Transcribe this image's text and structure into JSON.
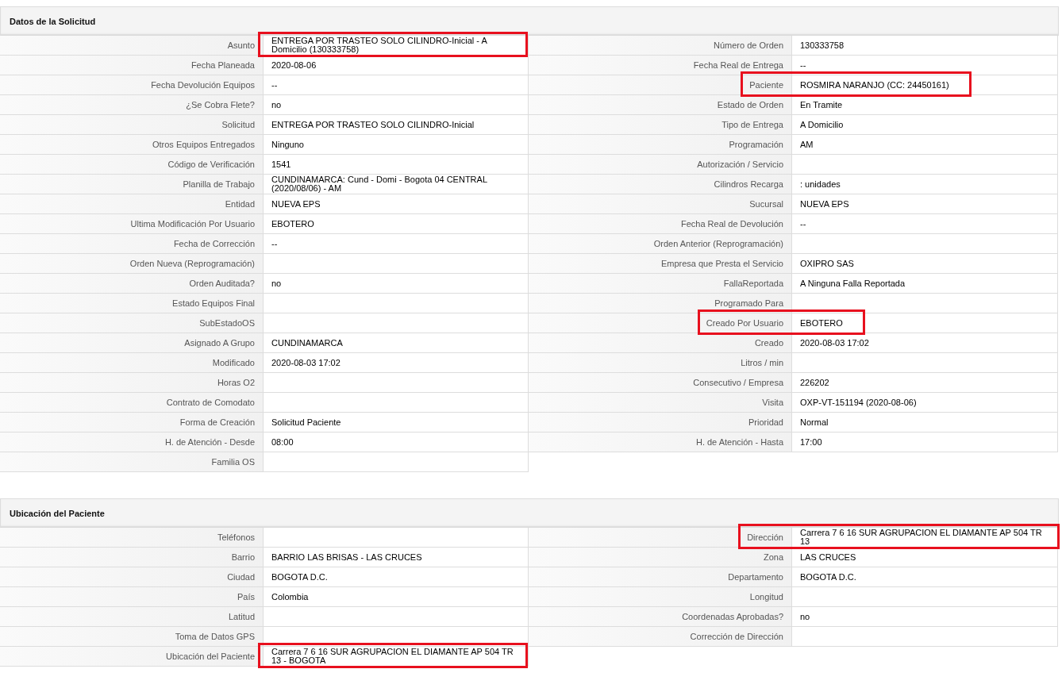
{
  "sections": [
    {
      "title": "Datos de la Solicitud",
      "left": [
        {
          "label": "Asunto",
          "value": "ENTREGA POR TRASTEO SOLO CILINDRO-Inicial - A Domicilio (130333758)",
          "highlighted": true
        },
        {
          "label": "Fecha Planeada",
          "value": "2020-08-06",
          "highlighted": false
        },
        {
          "label": "Fecha Devolución Equipos",
          "value": "--",
          "highlighted": false
        },
        {
          "label": "¿Se Cobra Flete?",
          "value": "no",
          "highlighted": false
        },
        {
          "label": "Solicitud",
          "value": "ENTREGA POR TRASTEO SOLO CILINDRO-Inicial",
          "highlighted": false
        },
        {
          "label": "Otros Equipos Entregados",
          "value": "Ninguno",
          "highlighted": false
        },
        {
          "label": "Código de Verificación",
          "value": "1541",
          "highlighted": false
        },
        {
          "label": "Planilla de Trabajo",
          "value": "CUNDINAMARCA: Cund - Domi - Bogota 04 CENTRAL (2020/08/06) - AM",
          "highlighted": false
        },
        {
          "label": "Entidad",
          "value": "NUEVA EPS",
          "highlighted": false
        },
        {
          "label": "Ultima Modificación Por Usuario",
          "value": "EBOTERO",
          "highlighted": false
        },
        {
          "label": "Fecha de Corrección",
          "value": "--",
          "highlighted": false
        },
        {
          "label": "Orden Nueva (Reprogramación)",
          "highlighted": false
        },
        {
          "label": "Orden Auditada?",
          "value": "no",
          "highlighted": false
        },
        {
          "label": "Estado Equipos Final",
          "highlighted": false
        },
        {
          "label": "SubEstadoOS",
          "highlighted": false
        },
        {
          "label": "Asignado A Grupo",
          "value": "CUNDINAMARCA",
          "highlighted": false
        },
        {
          "label": "Modificado",
          "value": "2020-08-03 17:02",
          "highlighted": false
        },
        {
          "label": "Horas O2",
          "highlighted": false
        },
        {
          "label": "Contrato de Comodato",
          "highlighted": false
        },
        {
          "label": "Forma de Creación",
          "value": "Solicitud Paciente",
          "highlighted": false
        },
        {
          "label": "H. de Atención - Desde",
          "value": "08:00",
          "highlighted": false
        },
        {
          "label": "Familia OS",
          "highlighted": false
        }
      ],
      "right": [
        {
          "label": "Número de Orden",
          "value": "130333758",
          "highlighted": false
        },
        {
          "label": "Fecha Real de Entrega",
          "value": "--",
          "highlighted": false
        },
        {
          "label": "Paciente",
          "value": "ROSMIRA NARANJO (CC: 24450161)",
          "highlighted": true
        },
        {
          "label": "Estado de Orden",
          "value": "En Tramite",
          "highlighted": false
        },
        {
          "label": "Tipo de Entrega",
          "value": "A Domicilio",
          "highlighted": false
        },
        {
          "label": "Programación",
          "value": "AM",
          "highlighted": false
        },
        {
          "label": "Autorización / Servicio",
          "highlighted": false
        },
        {
          "label": "Cilindros Recarga",
          "value": ": unidades",
          "highlighted": false
        },
        {
          "label": "Sucursal",
          "value": "NUEVA EPS",
          "highlighted": false
        },
        {
          "label": "Fecha Real de Devolución",
          "value": "--",
          "highlighted": false
        },
        {
          "label": "Orden Anterior (Reprogramación)",
          "highlighted": false
        },
        {
          "label": "Empresa que Presta el Servicio",
          "value": "OXIPRO SAS",
          "highlighted": false
        },
        {
          "label": "FallaReportada",
          "value": "A Ninguna Falla Reportada",
          "highlighted": false
        },
        {
          "label": "Programado Para",
          "highlighted": false
        },
        {
          "label": "Creado Por Usuario",
          "value": "EBOTERO",
          "highlighted": true
        },
        {
          "label": "Creado",
          "value": "2020-08-03 17:02",
          "highlighted": false
        },
        {
          "label": "Litros / min",
          "highlighted": false
        },
        {
          "label": "Consecutivo / Empresa",
          "value": "226202",
          "highlighted": false
        },
        {
          "label": "Visita",
          "value": "OXP-VT-151194 (2020-08-06)",
          "highlighted": false
        },
        {
          "label": "Prioridad",
          "value": "Normal",
          "highlighted": false
        },
        {
          "label": "H. de Atención - Hasta",
          "value": "17:00",
          "highlighted": false
        }
      ]
    },
    {
      "title": "Ubicación del Paciente",
      "left": [
        {
          "label": "Teléfonos",
          "highlighted": false
        },
        {
          "label": "Barrio",
          "value": "BARRIO LAS BRISAS - LAS CRUCES",
          "highlighted": false
        },
        {
          "label": "Ciudad",
          "value": "BOGOTA D.C.",
          "highlighted": false
        },
        {
          "label": "País",
          "value": "Colombia",
          "highlighted": false
        },
        {
          "label": "Latitud",
          "highlighted": false
        },
        {
          "label": "Toma de Datos GPS",
          "highlighted": false
        },
        {
          "label": "Ubicación del Paciente",
          "value": "Carrera 7 6 16 SUR AGRUPACION EL DIAMANTE AP 504 TR 13 - BOGOTA",
          "highlighted": true
        }
      ],
      "right": [
        {
          "label": "Dirección",
          "value": "Carrera 7 6 16 SUR AGRUPACION EL DIAMANTE AP 504 TR 13",
          "highlighted": true
        },
        {
          "label": "Zona",
          "value": "LAS CRUCES",
          "highlighted": false
        },
        {
          "label": "Departamento",
          "value": "BOGOTA D.C.",
          "highlighted": false
        },
        {
          "label": "Longitud",
          "highlighted": false
        },
        {
          "label": "Coordenadas Aprobadas?",
          "value": "no",
          "highlighted": false
        },
        {
          "label": "Corrección de Dirección",
          "highlighted": false
        }
      ]
    }
  ]
}
